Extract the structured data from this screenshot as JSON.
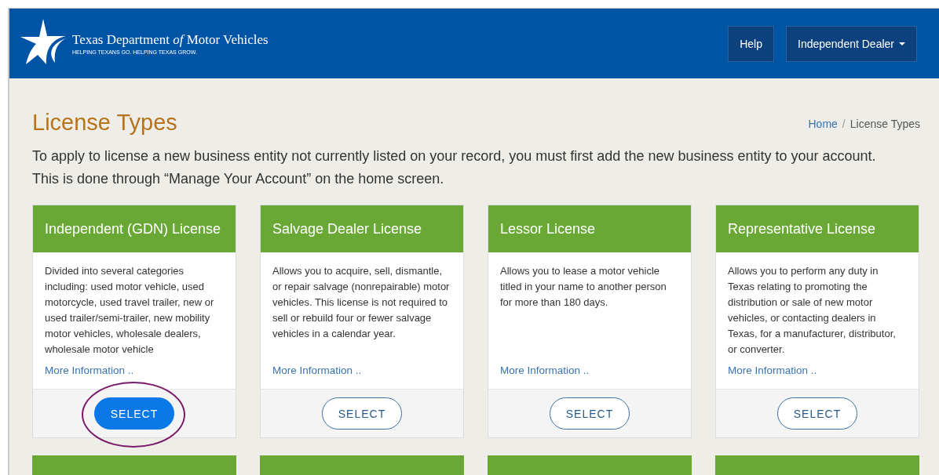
{
  "header": {
    "logo_title": "Texas Department *of* Motor Vehicles",
    "logo_tagline": "HELPING TEXANS GO. HELPING TEXAS GROW.",
    "help_button": "Help",
    "account_menu": "Independent Dealer"
  },
  "page": {
    "title": "License Types",
    "breadcrumb_separator": "/",
    "breadcrumb": [
      {
        "label": "Home",
        "link": true
      },
      {
        "label": "License Types",
        "link": false
      }
    ],
    "intro": "To apply to license a new business entity not currently listed on your record, you must first add the new business entity to your account. This is done through “Manage Your Account” on the home screen."
  },
  "cards": [
    {
      "kind": "full",
      "title": "Independent (GDN) License",
      "description": "Divided into several categories including: used motor vehicle, used motorcycle, used travel trailer, new or used trailer/semi-trailer, new mobility motor vehicles, wholesale dealers, wholesale motor vehicle",
      "link": "More Information ..",
      "button": "SELECT",
      "selected": true,
      "circled": true
    },
    {
      "kind": "full",
      "title": "Salvage Dealer License",
      "description": "Allows you to acquire, sell, dismantle, or repair salvage (nonrepairable) motor vehicles. This license is not required to sell or rebuild four or fewer salvage vehicles in a calendar year.",
      "link": "More Information ..",
      "button": "SELECT",
      "selected": false,
      "circled": false
    },
    {
      "kind": "full",
      "title": "Lessor License",
      "description": "Allows you to lease a motor vehicle titled in your name to another person for more than 180 days.",
      "link": "More Information ..",
      "button": "SELECT",
      "selected": false,
      "circled": false
    },
    {
      "kind": "full",
      "title": "Representative License",
      "description": "Allows you to perform any duty in Texas relating to promoting the distribution or sale of new motor vehicles, or contacting dealers in Texas, for a manufacturer, distributor, or converter.",
      "link": "More Information ..",
      "button": "SELECT",
      "selected": false,
      "circled": false
    },
    {
      "kind": "cut"
    },
    {
      "kind": "cut"
    },
    {
      "kind": "cut"
    },
    {
      "kind": "cut"
    }
  ]
}
